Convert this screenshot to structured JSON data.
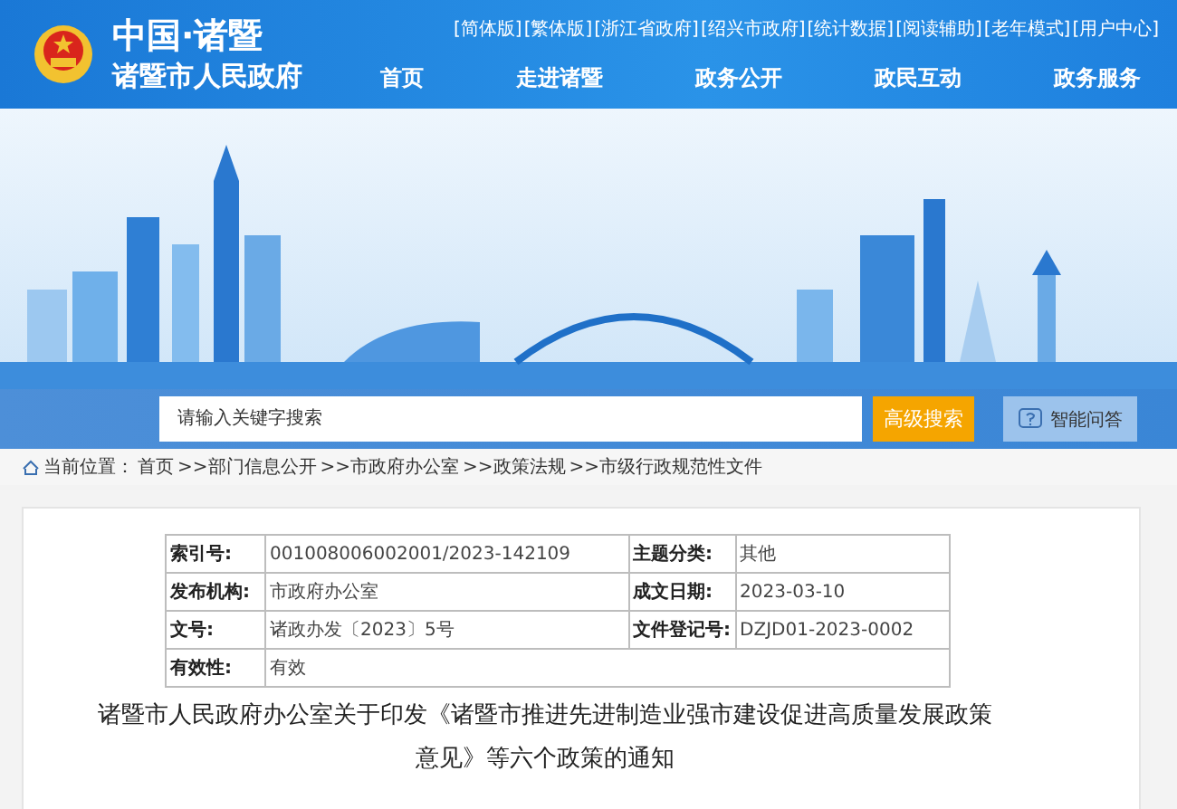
{
  "header": {
    "logo_top": "中国·诸暨",
    "logo_bottom": "诸暨市人民政府",
    "top_links": [
      "[简体版]",
      "[繁体版]",
      "[浙江省政府]",
      "[绍兴市政府]",
      "[统计数据]",
      "[阅读辅助]",
      "[老年模式]",
      "[用户中心]"
    ],
    "nav": [
      "首页",
      "走进诸暨",
      "政务公开",
      "政民互动",
      "政务服务"
    ]
  },
  "search": {
    "placeholder": "请输入关键字搜索",
    "button": "高级搜索",
    "qa_button": "智能问答"
  },
  "breadcrumb": {
    "label": "当前位置：",
    "items": [
      "首页",
      ">>部门信息公开",
      ">>市政府办公室",
      ">>政策法规",
      ">>市级行政规范性文件"
    ]
  },
  "info_table": {
    "rows": [
      {
        "label": "索引号:",
        "value": "001008006002001/2023-142109",
        "label_2": "主题分类:",
        "value_2": "其他"
      },
      {
        "label": "发布机构:",
        "value": "市政府办公室",
        "label_2": "成文日期:",
        "value_2": "2023-03-10"
      },
      {
        "label": "文号:",
        "value": "诸政办发〔2023〕5号",
        "label_2": "文件登记号:",
        "value_2": "DZJD01-2023-0002"
      },
      {
        "label": "有效性:",
        "value": "有效"
      }
    ]
  },
  "article_title": "诸暨市人民政府办公室关于印发《诸暨市推进先进制造业强市建设促进高质量发展政策意见》等六个政策的通知"
}
